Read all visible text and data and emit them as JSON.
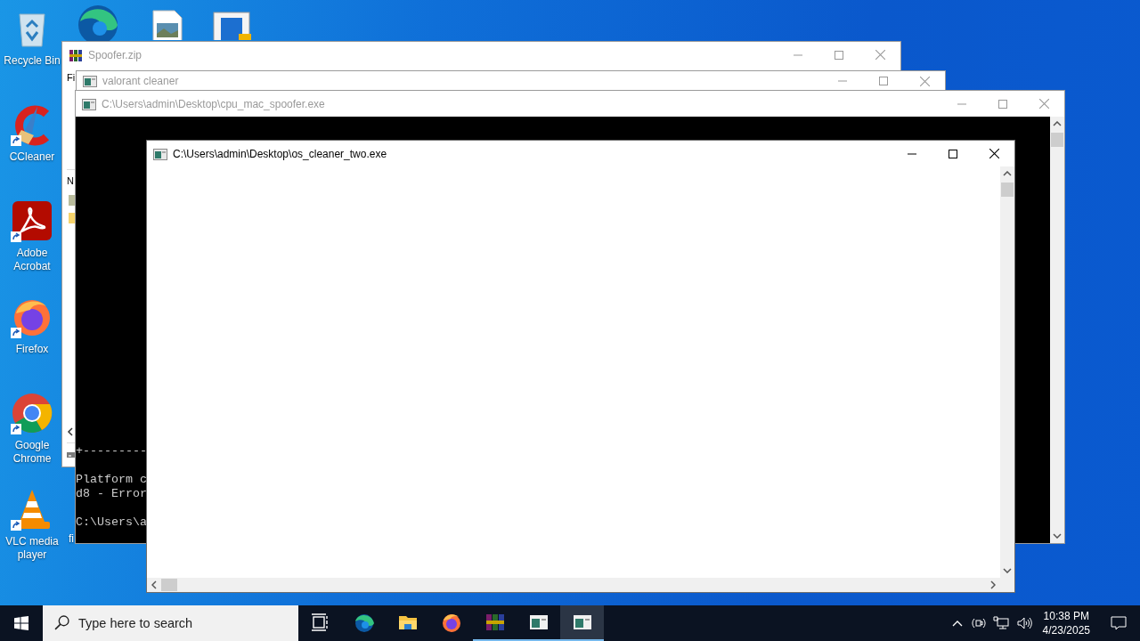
{
  "desktop": {
    "icons": [
      {
        "label": "Recycle Bin",
        "kind": "recycle-bin",
        "shortcut": false
      },
      {
        "label": "CCleaner",
        "kind": "ccleaner",
        "shortcut": true
      },
      {
        "label": "Adobe Acrobat",
        "kind": "acrobat",
        "shortcut": true
      },
      {
        "label": "Firefox",
        "kind": "firefox",
        "shortcut": true
      },
      {
        "label": "Google Chrome",
        "kind": "chrome",
        "shortcut": true
      },
      {
        "label": "VLC media player",
        "kind": "vlc",
        "shortcut": true
      }
    ],
    "top_icons": [
      {
        "kind": "edge"
      },
      {
        "kind": "image-file"
      },
      {
        "kind": "app-window"
      }
    ],
    "cut_label": "fi"
  },
  "windows": [
    {
      "kind": "archive",
      "title": "Spoofer.zip",
      "active": false,
      "menu": [
        "Fi"
      ],
      "column": "N"
    },
    {
      "kind": "plain",
      "title": "valorant cleaner",
      "active": false
    },
    {
      "kind": "console",
      "title": "C:\\Users\\admin\\Desktop\\cpu_mac_spoofer.exe",
      "active": false,
      "blocks": [
        [
          "+---------"
        ],
        [
          "Platform c",
          "d8 - Error"
        ],
        [
          "C:\\Users\\a"
        ]
      ]
    },
    {
      "kind": "blank-console",
      "title": "C:\\Users\\admin\\Desktop\\os_cleaner_two.exe",
      "active": true
    }
  ],
  "taskbar": {
    "search": {
      "placeholder": "Type here to search"
    },
    "apps": [
      {
        "kind": "task-view",
        "running": false,
        "active": false
      },
      {
        "kind": "edge",
        "running": false,
        "active": false
      },
      {
        "kind": "explorer",
        "running": false,
        "active": false
      },
      {
        "kind": "firefox",
        "running": false,
        "active": false
      },
      {
        "kind": "winrar",
        "running": true,
        "active": false
      },
      {
        "kind": "console",
        "running": true,
        "active": false
      },
      {
        "kind": "console",
        "running": true,
        "active": true
      }
    ],
    "clock": {
      "time": "10:38 PM",
      "date": "4/23/2025"
    }
  }
}
